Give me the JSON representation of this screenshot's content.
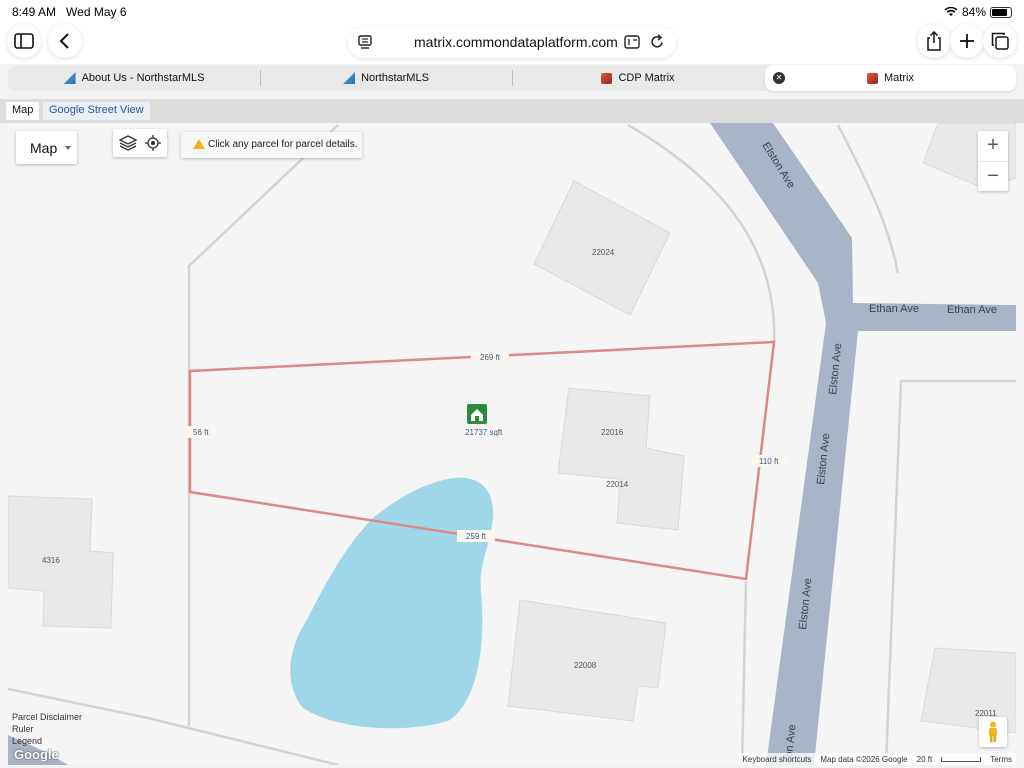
{
  "status": {
    "time": "8:49 AM",
    "date": "Wed May 6",
    "battery": "84%",
    "battery_fraction": 0.84
  },
  "browser": {
    "url": "matrix.commondataplatform.com",
    "tabs": [
      {
        "label": "About Us - NorthstarMLS"
      },
      {
        "label": "NorthstarMLS"
      },
      {
        "label": "CDP Matrix"
      },
      {
        "label": "Matrix"
      }
    ]
  },
  "map_tabs": {
    "map": "Map",
    "street_view": "Google Street View"
  },
  "map": {
    "map_type": "Map",
    "info": "Click any parcel for parcel details.",
    "zoom_in": "+",
    "zoom_out": "−",
    "streets": {
      "elston_1": "Elston Ave",
      "elston_2": "Elston Ave",
      "elston_3": "Elston Ave",
      "elston_4": "on Ave",
      "ethan_1": "Ethan Ave",
      "ethan_2": "Ethan Ave"
    },
    "buildings": {
      "b22024": "22024",
      "b22016": "22016",
      "b22014": "22014",
      "b4316": "4316",
      "b22008": "22008",
      "b22011": "22011"
    },
    "parcel": {
      "top": "269 ft",
      "left": "56 ft",
      "right": "110 ft",
      "bottom": "259 ft",
      "area": "21737 sqft"
    },
    "links": {
      "disclaimer": "Parcel Disclaimer",
      "ruler": "Ruler",
      "legend": "Legend"
    },
    "logo": "Google",
    "attribution": {
      "shortcuts": "Keyboard shortcuts",
      "data": "Map data ©2026 Google",
      "scale": "20 ft",
      "terms": "Terms"
    },
    "colors": {
      "road": "#a9b5c6",
      "water": "#9fd6ea",
      "parcel_line": "#d98a86",
      "building": "#e8e8ea",
      "marker": "#2e8b3a"
    }
  }
}
